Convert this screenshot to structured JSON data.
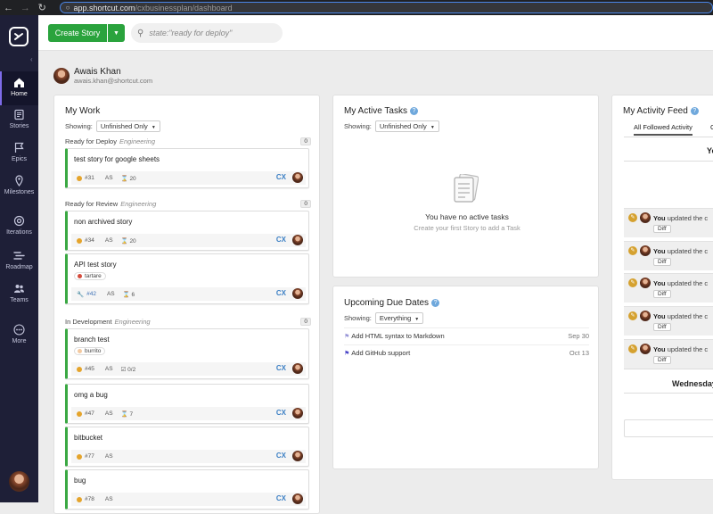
{
  "browser": {
    "url_host": "app.shortcut.com",
    "url_path": "/cxbusinessplan/dashboard"
  },
  "sidebar": {
    "items": [
      {
        "label": "Home",
        "icon": "home-icon",
        "active": true
      },
      {
        "label": "Stories",
        "icon": "stories-icon"
      },
      {
        "label": "Epics",
        "icon": "epics-icon"
      },
      {
        "label": "Milestones",
        "icon": "milestones-icon"
      },
      {
        "label": "Iterations",
        "icon": "iterations-icon"
      },
      {
        "label": "Roadmap",
        "icon": "roadmap-icon"
      },
      {
        "label": "Teams",
        "icon": "teams-icon"
      },
      {
        "label": "More",
        "icon": "more-icon"
      }
    ]
  },
  "topbar": {
    "create_label": "Create Story",
    "search_placeholder": "state:\"ready for deploy\""
  },
  "profile": {
    "name": "Awais Khan",
    "email": "awais.khan@shortcut.com"
  },
  "my_work": {
    "title": "My Work",
    "showing_label": "Showing:",
    "filter": "Unfinished Only",
    "groups": [
      {
        "state": "Ready for Deploy",
        "team": "Engineering",
        "count": "0",
        "cards": [
          {
            "title": "test story for google sheets",
            "id": "#31",
            "owner": "AS",
            "estimate": "20"
          }
        ]
      },
      {
        "state": "Ready for Review",
        "team": "Engineering",
        "count": "0",
        "cards": [
          {
            "title": "non archived story",
            "id": "#34",
            "owner": "AS",
            "estimate": "20"
          },
          {
            "title": "API test story",
            "label": "tartare",
            "id": "#42",
            "owner": "AS",
            "estimate": "6"
          }
        ]
      },
      {
        "state": "In Development",
        "team": "Engineering",
        "count": "0",
        "cards": [
          {
            "title": "branch test",
            "label": "burrito",
            "id": "#45",
            "owner": "AS",
            "estimate": "0/2"
          },
          {
            "title": "omg a bug",
            "id": "#47",
            "owner": "AS",
            "estimate": "7"
          },
          {
            "title": "bitbucket",
            "id": "#77",
            "owner": "AS"
          },
          {
            "title": "bug",
            "id": "#78",
            "owner": "AS"
          }
        ]
      }
    ],
    "integration_badge": "CX"
  },
  "active_tasks": {
    "title": "My Active Tasks",
    "showing_label": "Showing:",
    "filter": "Unfinished Only",
    "empty_title": "You have no active tasks",
    "empty_sub": "Create your first Story to add a Task"
  },
  "due_dates": {
    "title": "Upcoming Due Dates",
    "showing_label": "Showing:",
    "filter": "Everything",
    "rows": [
      {
        "title": "Add HTML syntax to Markdown",
        "date": "Sep 30"
      },
      {
        "title": "Add GitHub support",
        "date": "Oct 13"
      }
    ]
  },
  "activity": {
    "title": "My Activity Feed",
    "tabs": [
      "All Followed Activity",
      "C"
    ],
    "day_heading_1": "Ye",
    "day_heading_2": "Wednesday",
    "rows": [
      {
        "who": "You",
        "text": " updated the c",
        "diff": "Diff"
      },
      {
        "who": "You",
        "text": " updated the c",
        "diff": "Diff"
      },
      {
        "who": "You",
        "text": " updated the c",
        "diff": "Diff"
      },
      {
        "who": "You",
        "text": " updated the c",
        "diff": "Diff"
      },
      {
        "who": "You",
        "text": " updated the c",
        "diff": "Diff"
      }
    ]
  },
  "colors": {
    "sidebar_bg": "#1e1f37",
    "accent_green": "#2aa33d",
    "story_feature": "#e5a42b",
    "label_tartare": "#d44b3c",
    "label_burrito": "#f3c9a0"
  }
}
